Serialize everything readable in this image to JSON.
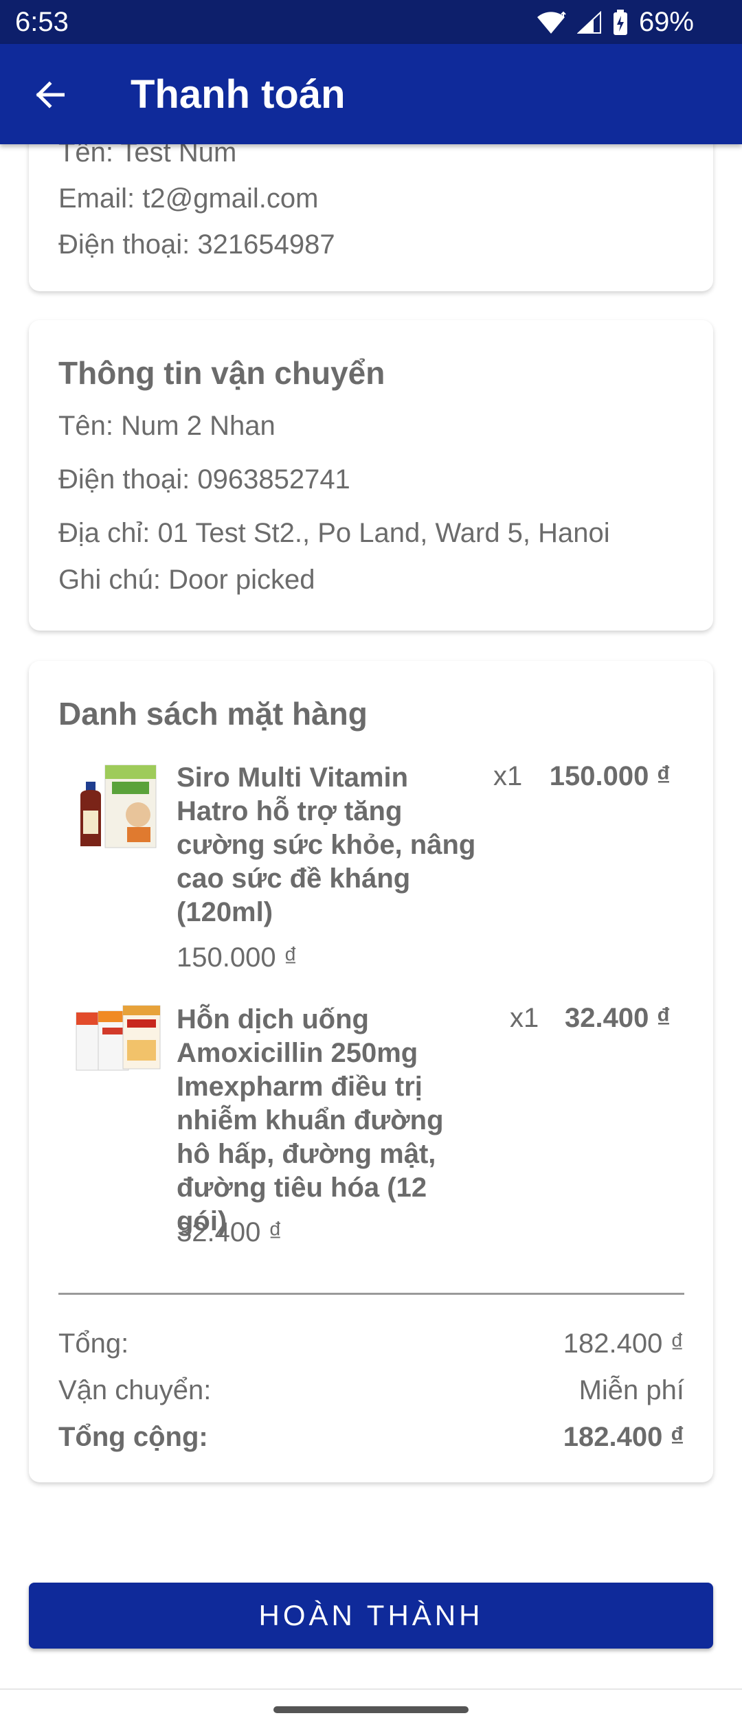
{
  "status_bar": {
    "time": "6:53",
    "battery": "69%"
  },
  "app_bar": {
    "title": "Thanh toán"
  },
  "customer": {
    "name_line": "Tên: Test Num",
    "email_line": "Email: t2@gmail.com",
    "phone_line": "Điện thoại: 321654987"
  },
  "shipping": {
    "title": "Thông tin vận chuyển",
    "name_line": "Tên: Num 2 Nhan",
    "phone_line": "Điện thoại: 0963852741",
    "address_line": "Địa chỉ: 01 Test St2., Po Land, Ward 5, Hanoi",
    "note_line": "Ghi chú: Door picked"
  },
  "items_section": {
    "title": "Danh sách mặt hàng",
    "items": [
      {
        "name": "Siro Multi Vitamin Hatro hỗ trợ tăng cường sức khỏe, nâng cao sức đề kháng (120ml)",
        "unit_price": "150.000 ₫",
        "qty": "x1",
        "total": "150.000 ₫",
        "image": "hatro-syrup-box"
      },
      {
        "name": "Hỗn dịch uống Amoxicillin 250mg Imexpharm điều trị nhiễm khuẩn đường hô hấp, đường mật, đường tiêu hóa (12 gói)",
        "unit_price": "32.400 ₫",
        "qty": "x1",
        "total": "32.400 ₫",
        "image": "amoxicillin-sachets-box"
      }
    ]
  },
  "summary": {
    "subtotal_label": "Tổng:",
    "subtotal_value": "182.400 ₫",
    "shipping_label": "Vận chuyển:",
    "shipping_value": "Miễn phí",
    "total_label": "Tổng cộng:",
    "total_value": "182.400 ₫"
  },
  "actions": {
    "complete_label": "HOÀN THÀNH"
  }
}
